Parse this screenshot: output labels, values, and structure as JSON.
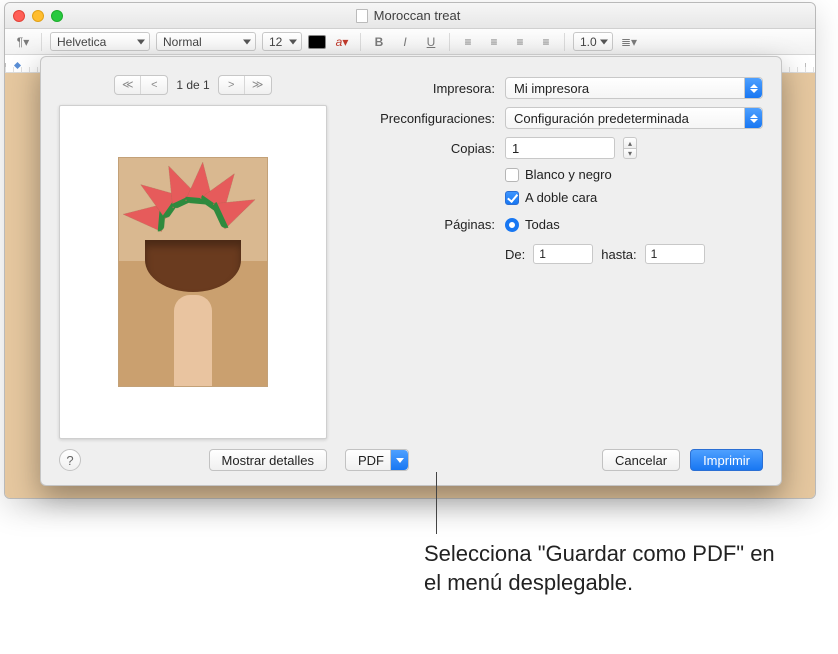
{
  "window": {
    "title": "Moroccan treat"
  },
  "toolbar": {
    "font": "Helvetica",
    "style": "Normal",
    "size": "12",
    "linespacing": "1.0"
  },
  "pager": {
    "first": "≪",
    "prev": "<",
    "count": "1 de 1",
    "next": ">",
    "last": "≫"
  },
  "labels": {
    "printer": "Impresora:",
    "presets": "Preconfiguraciones:",
    "copies": "Copias:",
    "bw": "Blanco y negro",
    "duplex": "A doble cara",
    "pages": "Páginas:",
    "all": "Todas",
    "from": "De:",
    "to": "hasta:"
  },
  "values": {
    "printer": "Mi impresora",
    "presets": "Configuración predeterminada",
    "copies": "1",
    "from": "1",
    "to": "1"
  },
  "buttons": {
    "showDetails": "Mostrar detalles",
    "pdf": "PDF",
    "cancel": "Cancelar",
    "print": "Imprimir",
    "help": "?"
  },
  "annotation": "Selecciona \"Guardar como PDF\" en el menú desplegable."
}
